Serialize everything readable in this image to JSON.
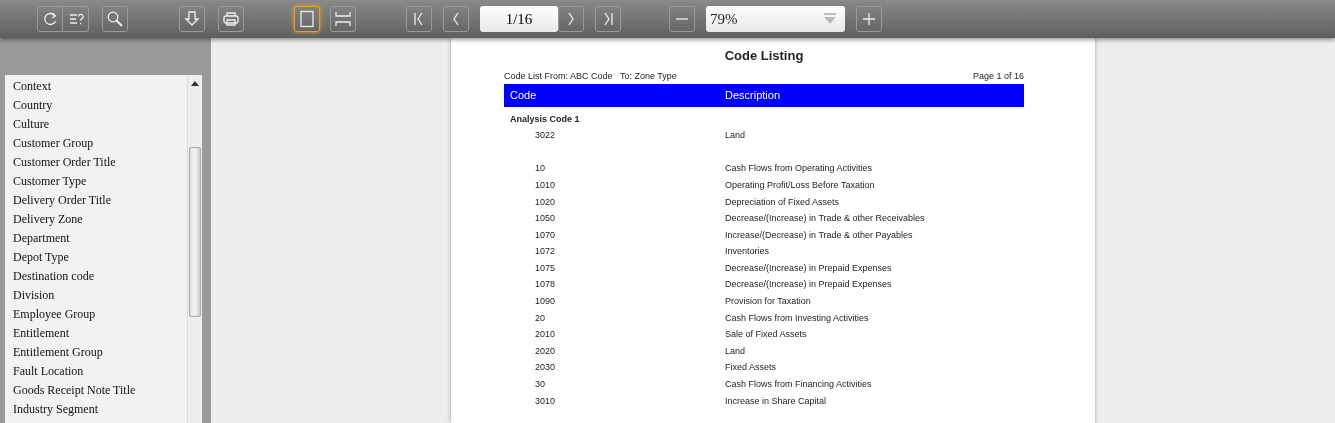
{
  "toolbar": {
    "groups": [
      {
        "buttons": [
          {
            "kind": "refresh",
            "selected": false
          },
          {
            "kind": "help",
            "selected": false
          }
        ]
      },
      {
        "buttons": [
          {
            "kind": "search",
            "selected": false
          }
        ]
      },
      {
        "buttons": [
          {
            "kind": "download",
            "selected": false
          }
        ]
      },
      {
        "buttons": [
          {
            "kind": "print",
            "selected": false
          }
        ]
      },
      {
        "buttons": [
          {
            "kind": "single-page",
            "selected": true
          }
        ]
      },
      {
        "buttons": [
          {
            "kind": "page-width",
            "selected": false
          }
        ]
      }
    ],
    "page_nav": {
      "first": {
        "kind": "first"
      },
      "prev": {
        "kind": "prev"
      },
      "page_value": "1/16",
      "next": {
        "kind": "next"
      },
      "last": {
        "kind": "last"
      }
    },
    "zoom": {
      "minus": {
        "kind": "minus"
      },
      "value": "79%",
      "plus": {
        "kind": "plus"
      }
    }
  },
  "sidebar": {
    "items": [
      {
        "label": "Context"
      },
      {
        "label": "Country"
      },
      {
        "label": "Culture"
      },
      {
        "label": "Customer Group"
      },
      {
        "label": "Customer Order Title"
      },
      {
        "label": "Customer Type"
      },
      {
        "label": "Delivery Order Title"
      },
      {
        "label": "Delivery Zone"
      },
      {
        "label": "Department"
      },
      {
        "label": "Depot Type"
      },
      {
        "label": "Destination code"
      },
      {
        "label": "Division"
      },
      {
        "label": "Employee Group"
      },
      {
        "label": "Entitlement"
      },
      {
        "label": "Entitlement Group"
      },
      {
        "label": "Fault Location"
      },
      {
        "label": "Goods Receipt Note Title"
      },
      {
        "label": "Industry Segment"
      }
    ]
  },
  "report": {
    "title": "Code Listing",
    "criteria": "Code List From: ABC Code   To: Zone Type",
    "page_label": "Page 1 of 16",
    "columns": [
      "Code",
      "Description"
    ],
    "rows": [
      {
        "kind": "group",
        "code": "Analysis Code 1"
      },
      {
        "kind": "item",
        "code": "3022",
        "description": "Land"
      },
      {
        "kind": "blank"
      },
      {
        "kind": "item",
        "code": "10",
        "description": "Cash Flows from Operating Activities"
      },
      {
        "kind": "item",
        "code": "1010",
        "description": "Operating Profit/Loss Before Taxation"
      },
      {
        "kind": "item",
        "code": "1020",
        "description": "Depreciation of Fixed Assets"
      },
      {
        "kind": "item",
        "code": "1050",
        "description": "Decrease/(Increase) in Trade & other Receivables"
      },
      {
        "kind": "item",
        "code": "1070",
        "description": "Increase/(Decrease) in Trade & other Payables"
      },
      {
        "kind": "item",
        "code": "1072",
        "description": "Inventories"
      },
      {
        "kind": "item",
        "code": "1075",
        "description": "Decrease/(Increase) in Prepaid Expenses"
      },
      {
        "kind": "item",
        "code": "1078",
        "description": "Decrease/(Increase) in Prepaid Expenses"
      },
      {
        "kind": "item",
        "code": "1090",
        "description": "Provision for Taxation"
      },
      {
        "kind": "item",
        "code": "20",
        "description": "Cash Flows from Investing Activities"
      },
      {
        "kind": "item",
        "code": "2010",
        "description": "Sale of Fixed Assets"
      },
      {
        "kind": "item",
        "code": "2020",
        "description": "Land"
      },
      {
        "kind": "item",
        "code": "2030",
        "description": "Fixed Assets"
      },
      {
        "kind": "item",
        "code": "30",
        "description": "Cash Flows from Financing Activities"
      },
      {
        "kind": "item",
        "code": "3010",
        "description": "Increase in Share Capital"
      }
    ]
  }
}
